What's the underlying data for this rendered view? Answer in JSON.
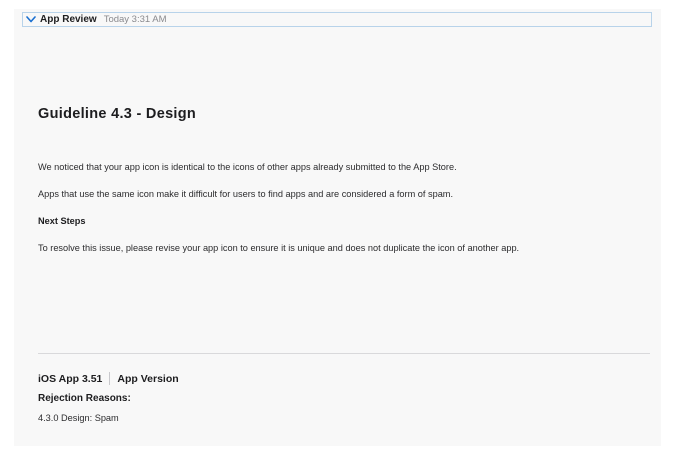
{
  "header": {
    "title": "App Review",
    "timestamp": "Today 3:31 AM",
    "toggle_icon": "chevron-down-icon"
  },
  "message": {
    "guideline_title": "Guideline 4.3 - Design",
    "paragraph_1": "We noticed that your app icon is identical to the icons of other apps already submitted to the App Store.",
    "paragraph_2": "Apps that use the same icon make it difficult for users to find apps and are considered a form of spam.",
    "next_steps_heading": "Next Steps",
    "paragraph_3": "To resolve this issue, please revise your app icon to ensure it is unique and does not duplicate the icon of another app."
  },
  "footer": {
    "platform_version": "iOS App 3.51",
    "version_type": "App Version",
    "rejection_label": "Rejection Reasons:",
    "rejection_reason": "4.3.0 Design: Spam"
  },
  "colors": {
    "panel_background": "#f8f8f8",
    "header_border": "#b8d3ea",
    "chevron": "#1a6fd0"
  }
}
